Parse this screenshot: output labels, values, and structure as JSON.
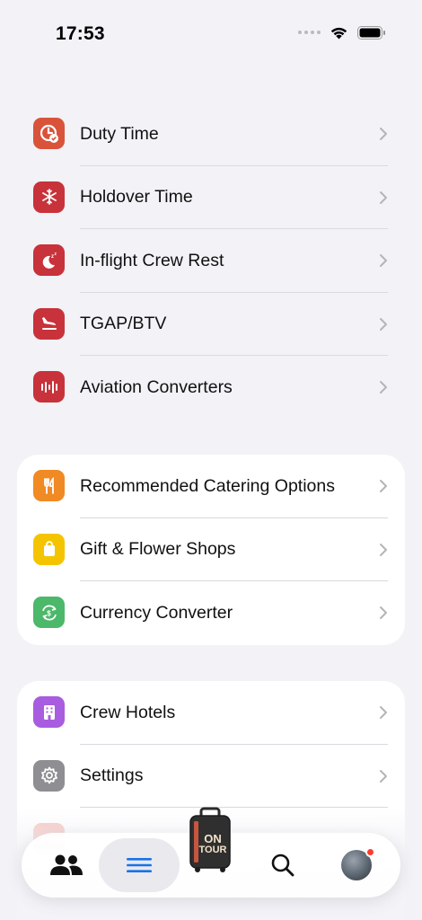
{
  "status_bar": {
    "time": "17:53"
  },
  "section_tools": {
    "items": [
      {
        "label": "Duty Time",
        "icon": "clock-check-icon",
        "color": "#d9533a"
      },
      {
        "label": "Holdover Time",
        "icon": "snowflake-icon",
        "color": "#c8323a"
      },
      {
        "label": "In-flight Crew Rest",
        "icon": "moon-zzz-icon",
        "color": "#c8323a"
      },
      {
        "label": "TGAP/BTV",
        "icon": "plane-landing-icon",
        "color": "#c8323a"
      },
      {
        "label": "Aviation Converters",
        "icon": "waveform-icon",
        "color": "#c8323a"
      }
    ]
  },
  "section_services": {
    "items": [
      {
        "label": "Recommended Catering Options",
        "icon": "fork-knife-icon",
        "color": "#f08a24"
      },
      {
        "label": "Gift & Flower Shops",
        "icon": "shopping-bag-icon",
        "color": "#f5c400"
      },
      {
        "label": "Currency Converter",
        "icon": "currency-exchange-icon",
        "color": "#4cb86a"
      }
    ]
  },
  "section_more": {
    "items": [
      {
        "label": "Crew Hotels",
        "icon": "building-icon",
        "color": "#a85ce0"
      },
      {
        "label": "Settings",
        "icon": "gear-icon",
        "color": "#8e8e93"
      }
    ]
  },
  "tab_bar": {
    "tabs": [
      {
        "name": "crew-tab",
        "icon": "people-icon",
        "active": false
      },
      {
        "name": "menu-tab",
        "icon": "menu-lines-icon",
        "active": true
      },
      {
        "name": "on-tour-tab",
        "icon": "suitcase-icon",
        "active": false
      },
      {
        "name": "search-tab",
        "icon": "search-icon",
        "active": false
      },
      {
        "name": "profile-tab",
        "icon": "avatar-icon",
        "active": false
      }
    ],
    "suitcase_text": [
      "ON",
      "TOUR"
    ],
    "accent_color": "#1a73e8"
  }
}
